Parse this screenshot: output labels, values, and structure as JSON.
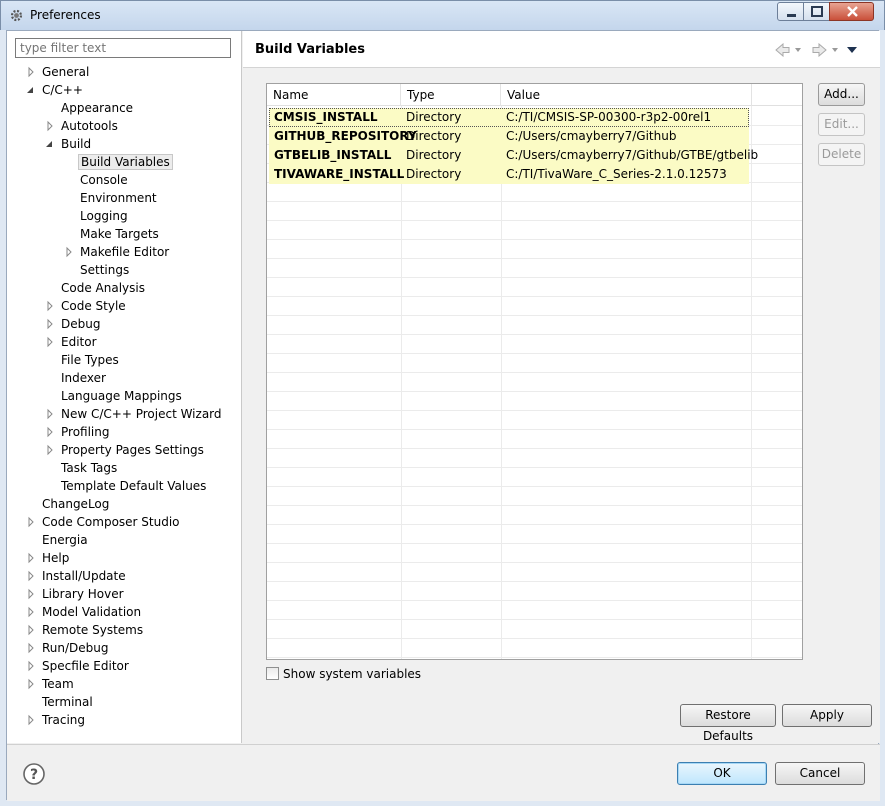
{
  "window": {
    "title": "Preferences",
    "icon": "gear-icon"
  },
  "filter": {
    "placeholder": "type filter text",
    "value": ""
  },
  "tree": [
    {
      "label": "General",
      "level": 0,
      "expander": "collapsed"
    },
    {
      "label": "C/C++",
      "level": 0,
      "expander": "expanded"
    },
    {
      "label": "Appearance",
      "level": 1,
      "expander": "none"
    },
    {
      "label": "Autotools",
      "level": 1,
      "expander": "collapsed"
    },
    {
      "label": "Build",
      "level": 1,
      "expander": "expanded"
    },
    {
      "label": "Build Variables",
      "level": 2,
      "expander": "none",
      "selected": true
    },
    {
      "label": "Console",
      "level": 2,
      "expander": "none"
    },
    {
      "label": "Environment",
      "level": 2,
      "expander": "none"
    },
    {
      "label": "Logging",
      "level": 2,
      "expander": "none"
    },
    {
      "label": "Make Targets",
      "level": 2,
      "expander": "none"
    },
    {
      "label": "Makefile Editor",
      "level": 2,
      "expander": "collapsed"
    },
    {
      "label": "Settings",
      "level": 2,
      "expander": "none"
    },
    {
      "label": "Code Analysis",
      "level": 1,
      "expander": "none"
    },
    {
      "label": "Code Style",
      "level": 1,
      "expander": "collapsed"
    },
    {
      "label": "Debug",
      "level": 1,
      "expander": "collapsed"
    },
    {
      "label": "Editor",
      "level": 1,
      "expander": "collapsed"
    },
    {
      "label": "File Types",
      "level": 1,
      "expander": "none"
    },
    {
      "label": "Indexer",
      "level": 1,
      "expander": "none"
    },
    {
      "label": "Language Mappings",
      "level": 1,
      "expander": "none"
    },
    {
      "label": "New C/C++ Project Wizard",
      "level": 1,
      "expander": "collapsed"
    },
    {
      "label": "Profiling",
      "level": 1,
      "expander": "collapsed"
    },
    {
      "label": "Property Pages Settings",
      "level": 1,
      "expander": "collapsed"
    },
    {
      "label": "Task Tags",
      "level": 1,
      "expander": "none"
    },
    {
      "label": "Template Default Values",
      "level": 1,
      "expander": "none"
    },
    {
      "label": "ChangeLog",
      "level": 0,
      "expander": "none"
    },
    {
      "label": "Code Composer Studio",
      "level": 0,
      "expander": "collapsed"
    },
    {
      "label": "Energia",
      "level": 0,
      "expander": "none"
    },
    {
      "label": "Help",
      "level": 0,
      "expander": "collapsed"
    },
    {
      "label": "Install/Update",
      "level": 0,
      "expander": "collapsed"
    },
    {
      "label": "Library Hover",
      "level": 0,
      "expander": "collapsed"
    },
    {
      "label": "Model Validation",
      "level": 0,
      "expander": "collapsed"
    },
    {
      "label": "Remote Systems",
      "level": 0,
      "expander": "collapsed"
    },
    {
      "label": "Run/Debug",
      "level": 0,
      "expander": "collapsed"
    },
    {
      "label": "Specfile Editor",
      "level": 0,
      "expander": "collapsed"
    },
    {
      "label": "Team",
      "level": 0,
      "expander": "collapsed"
    },
    {
      "label": "Terminal",
      "level": 0,
      "expander": "none"
    },
    {
      "label": "Tracing",
      "level": 0,
      "expander": "collapsed"
    }
  ],
  "page": {
    "title": "Build Variables",
    "nav_icons": [
      "back-arrow-icon",
      "back-dropdown-icon",
      "forward-arrow-icon",
      "forward-dropdown-icon",
      "view-menu-icon"
    ]
  },
  "table": {
    "columns": [
      "Name",
      "Type",
      "Value"
    ],
    "rows": [
      {
        "name": "CMSIS_INSTALL",
        "type": "Directory",
        "value": "C:/TI/CMSIS-SP-00300-r3p2-00rel1"
      },
      {
        "name": "GITHUB_REPOSITORY",
        "type": "Directory",
        "value": "C:/Users/cmayberry7/Github"
      },
      {
        "name": "GTBELIB_INSTALL",
        "type": "Directory",
        "value": "C:/Users/cmayberry7/Github/GTBE/gtbelib"
      },
      {
        "name": "TIVAWARE_INSTALL",
        "type": "Directory",
        "value": "C:/TI/TivaWare_C_Series-2.1.0.12573"
      }
    ],
    "row_highlight": "#fbfbc5"
  },
  "side_buttons": {
    "add": "Add...",
    "edit": "Edit...",
    "delete": "Delete"
  },
  "show_system_variables": {
    "label": "Show system variables",
    "checked": false
  },
  "buttons": {
    "restore_defaults": "Restore Defaults",
    "apply": "Apply",
    "ok": "OK",
    "cancel": "Cancel"
  }
}
